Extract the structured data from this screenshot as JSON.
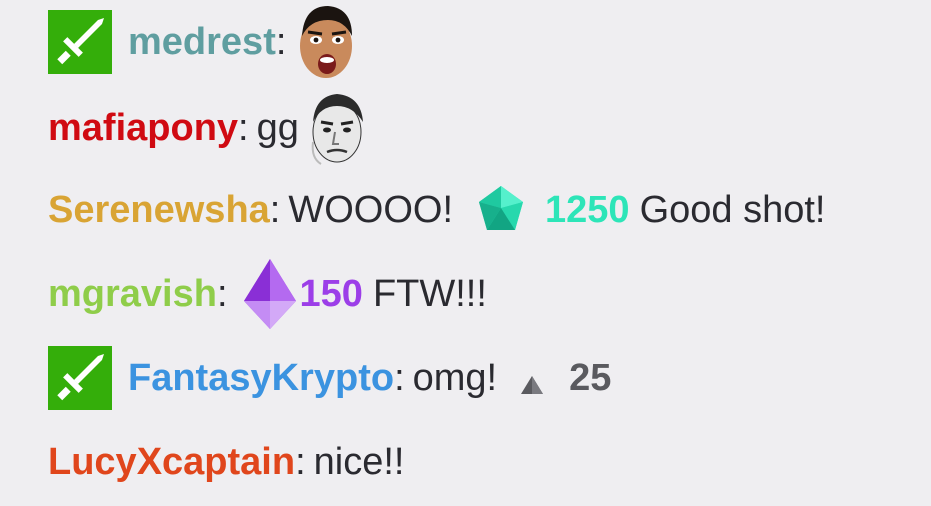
{
  "colors": {
    "background": "#efeef1",
    "moderator_badge": "#34ae0a",
    "cheer_teal": "#2de5b8",
    "cheer_purple": "#9c3ee8",
    "cheer_gray": "#5a5a5f"
  },
  "messages": [
    {
      "badge": "moderator-sword-icon",
      "username": "medrest",
      "username_color": "#5f9ea0",
      "colon": ":",
      "emote": "pogchamp-emote"
    },
    {
      "username": "mafiapony",
      "username_color": "#d00a12",
      "colon": ":",
      "text": "gg",
      "emote": "kappa-emote"
    },
    {
      "username": "Serenewsha",
      "username_color": "#d9a434",
      "colon": ":",
      "text": "WOOOO!",
      "cheer_icon": "teal-gem-bits-icon",
      "cheer_amount": "1250",
      "after_text": "Good shot!"
    },
    {
      "username": "mgravish",
      "username_color": "#8fcd4a",
      "colon": ":",
      "cheer_icon": "purple-crystal-bits-icon",
      "cheer_amount": "150",
      "after_text": "FTW!!!"
    },
    {
      "badge": "moderator-sword-icon",
      "username": "FantasyKrypto",
      "username_color": "#3b93e0",
      "colon": ":",
      "text": "omg!",
      "cheer_icon": "gray-triangle-bits-icon",
      "cheer_amount": "25"
    },
    {
      "username": "LucyXcaptain",
      "username_color": "#e0461c",
      "colon": ":",
      "text": "nice!!"
    }
  ]
}
